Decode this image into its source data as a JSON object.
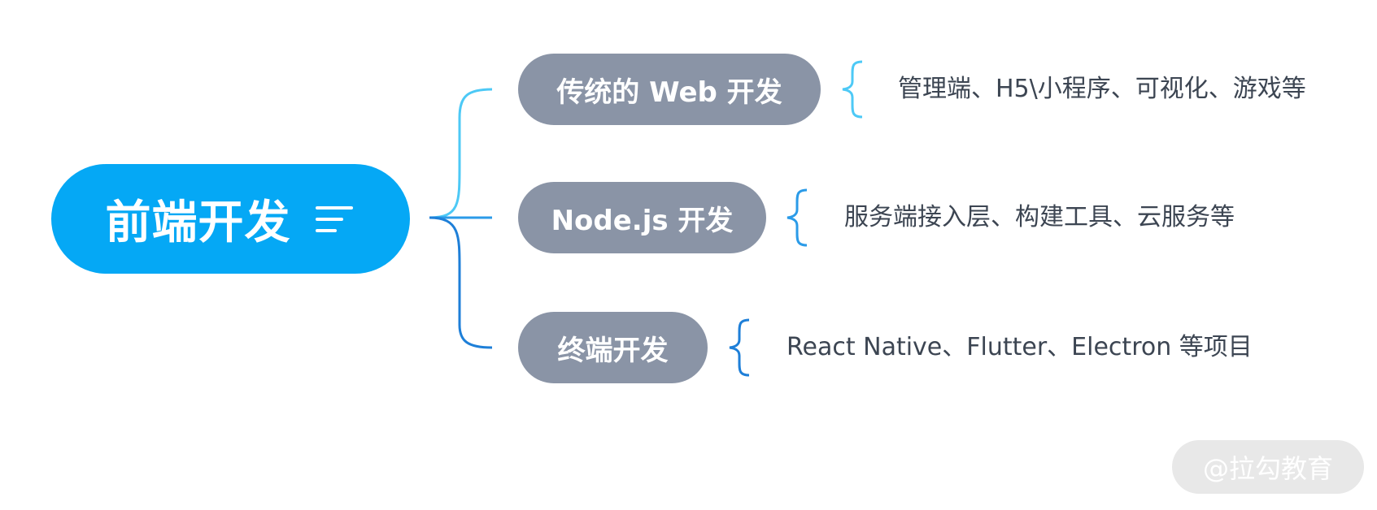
{
  "root": {
    "title": "前端开发",
    "icon": "notes-icon",
    "color": "#05a8f5"
  },
  "branches": [
    {
      "label": "传统的 Web 开发",
      "detail": "管理端、H5\\小程序、可视化、游戏等",
      "connector_color": "#4dc9f6"
    },
    {
      "label": "Node.js 开发",
      "detail": "服务端接入层、构建工具、云服务等",
      "connector_color": "#2b9be8"
    },
    {
      "label": "终端开发",
      "detail": "React Native、Flutter、Electron 等项目",
      "connector_color": "#1e7fd8"
    }
  ],
  "branch_color": "#8a94a6",
  "watermark": "@拉勾教育"
}
